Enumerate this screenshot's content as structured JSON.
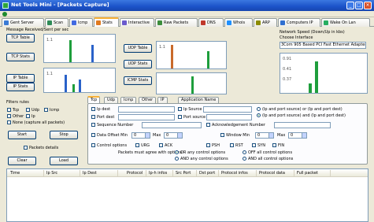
{
  "window": {
    "title": "Net Tools Mini - [Packets Capture]"
  },
  "tabs": [
    {
      "label": "Gent Server",
      "icon": "server-icon",
      "color": "#3a7bd5"
    },
    {
      "label": "Scan",
      "icon": "scan-icon",
      "color": "#2e8b57"
    },
    {
      "label": "Icmp",
      "icon": "icmp-icon",
      "color": "#4169e1"
    },
    {
      "label": "Stats",
      "icon": "stats-icon",
      "color": "#e07a1f"
    },
    {
      "label": "Interactive",
      "icon": "interactive-icon",
      "color": "#6a5acd"
    },
    {
      "label": "Raw Packets",
      "icon": "packets-icon",
      "color": "#3c8d3c"
    },
    {
      "label": "DNS",
      "icon": "dns-icon",
      "color": "#c0392b"
    },
    {
      "label": "Whois",
      "icon": "whois-icon",
      "color": "#1e90ff"
    },
    {
      "label": "ARP",
      "icon": "arp-icon",
      "color": "#8b8b00"
    },
    {
      "label": "Computers IP",
      "icon": "computer-icon",
      "color": "#2f6fd0"
    },
    {
      "label": "Wake On Lan",
      "icon": "wol-icon",
      "color": "#27ae60"
    }
  ],
  "stats": {
    "left_title": "Message Received/Sent per sec",
    "right_title": "Network Speed (Down/Up in kbs)",
    "choose_interface": "Choose Interface",
    "interface_value": "3Com 905 Based PCI Fast Ethernet Adapter",
    "buttons": [
      "TCP Table",
      "TCP Stats",
      "IP Table",
      "IP Stats",
      "UDP Table",
      "UDP Stats",
      "ICMP Stats"
    ],
    "axis_small": "1.1",
    "axis_values": [
      "0.91",
      "0.41",
      "0.37"
    ],
    "bar_color_green": "#1e9e3c",
    "bar_color_blue": "#2a62c9"
  },
  "filters": {
    "title": "Filters rules",
    "protocols": [
      {
        "label": "Tcp",
        "checked": false
      },
      {
        "label": "Udp",
        "checked": false
      },
      {
        "label": "Icmp",
        "checked": false
      },
      {
        "label": "Other",
        "checked": false
      },
      {
        "label": "Ip",
        "checked": false
      }
    ],
    "none_label": "None (capture all packets)",
    "start": "Start",
    "stop": "Stop",
    "packets_details": "Packets details",
    "clear": "Clear",
    "load": "Load"
  },
  "filter_tabs": [
    "Tcp",
    "Udp",
    "Icmp",
    "Other",
    "IP",
    "Application Name"
  ],
  "tcp_options": {
    "ip_dest": "Ip dest",
    "ip_source": "Ip Source",
    "port_dest": "Port dest",
    "port_source": "Port source",
    "sequence_number": "Sequence Number",
    "ack_number": "Acknowledgement Number",
    "data_offset": "Data Offset Min",
    "max": "Max",
    "window": "Window Min",
    "radio_any": "(Ip and port source) or (Ip and port dest)",
    "radio_all": "(Ip and port source) and (Ip and port dest)",
    "control_options": "Control options",
    "flags": [
      "URG",
      "ACK",
      "PSH",
      "RST",
      "SYN",
      "FIN"
    ],
    "must_match": "Packets must agree with options",
    "or_any": "OR any control options",
    "and_any": "AND any control options",
    "off_all": "OFF all control options",
    "and_all": "AND all control options",
    "spin_value": "0"
  },
  "grid": {
    "columns": [
      "Time",
      "Ip Src",
      "Ip Dest",
      "Protocol",
      "Ip-h infos",
      "Src Port",
      "Dst port",
      "Protocol infos",
      "Protocol data",
      "Full packet"
    ]
  }
}
